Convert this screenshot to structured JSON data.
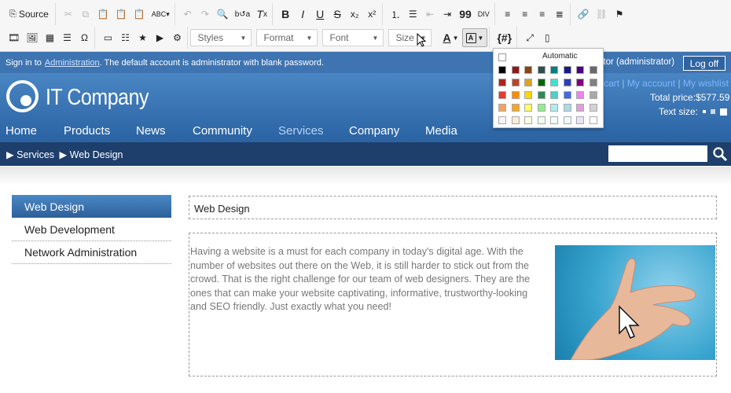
{
  "toolbar": {
    "source_label": "Source",
    "styles_label": "Styles",
    "format_label": "Format",
    "font_label": "Font",
    "size_label": "Size",
    "bold": "B",
    "italic": "I",
    "underline": "U",
    "strike": "S",
    "subscript": "x₂",
    "superscript": "x²",
    "blockquote": "99",
    "templates": "{#}"
  },
  "login_bar": {
    "prefix": "Sign in to",
    "link": "Administration",
    "suffix": ". The default account is administrator with blank password.",
    "user": "ator (administrator)",
    "logoff": "Log off"
  },
  "header": {
    "logo": "IT Company",
    "links": [
      "cart",
      "My account",
      "My wishlist"
    ],
    "total_price": "Total price:$577.59",
    "text_size": "Text size:"
  },
  "nav": {
    "items": [
      "Home",
      "Products",
      "News",
      "Community",
      "Services",
      "Company",
      "Media"
    ],
    "active": "Services"
  },
  "breadcrumb": {
    "items": [
      "Services",
      "Web Design"
    ]
  },
  "sidebar": {
    "items": [
      "Web Design",
      "Web Development",
      "Network Administration"
    ],
    "selected": "Web Design"
  },
  "page": {
    "title": "Web Design",
    "body": "Having a website is a must for each company in today's digital age. With the number of websites out there on the Web, it is still harder to stick out from the crowd. That is the right challenge for our team of web designers. They are the ones that can make your website captivating, informative, trustworthy-looking and SEO friendly. Just exactly what you need!"
  },
  "color_panel": {
    "automatic_label": "Automatic",
    "colors": [
      [
        "#000000",
        "#8b1a1a",
        "#8b4513",
        "#2f4f4f",
        "#008080",
        "#1a1a8b",
        "#4b0082",
        "#696969"
      ],
      [
        "#b22222",
        "#b8452b",
        "#daa520",
        "#006400",
        "#40e0d0",
        "#2b3fb8",
        "#800080",
        "#808080"
      ],
      [
        "#e53b2e",
        "#ff8c00",
        "#ffd700",
        "#2e8b57",
        "#48d1cc",
        "#4169e1",
        "#ee82ee",
        "#a9a9a9"
      ],
      [
        "#f4a460",
        "#f5a623",
        "#ffff66",
        "#90ee90",
        "#afeeee",
        "#add8e6",
        "#dda0dd",
        "#d3d3d3"
      ],
      [
        "#fff0f5",
        "#faebd7",
        "#ffffe0",
        "#f0fff0",
        "#f0ffff",
        "#f0f8ff",
        "#e6e6fa",
        "#ffffff"
      ]
    ]
  },
  "colors": {
    "login_bar": "#3d74b1",
    "header": "#2a62a2",
    "breadcrumb_bar": "#1e3f6c",
    "selected_item": "#3a73b4"
  }
}
